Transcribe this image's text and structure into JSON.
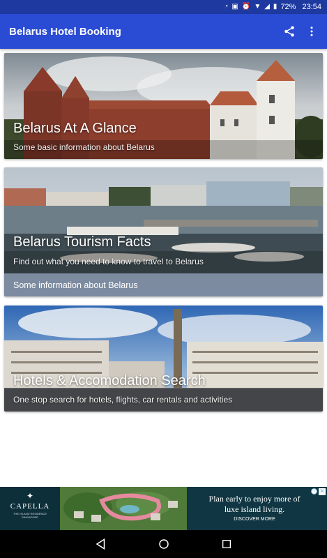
{
  "status_bar": {
    "battery": "72%",
    "time": "23:54"
  },
  "app_bar": {
    "title": "Belarus Hotel Booking"
  },
  "cards": [
    {
      "title": "Belarus At A Glance",
      "subtitle": "Some basic information about Belarus"
    },
    {
      "title": "Belarus Tourism Facts",
      "subtitle": "Find out what you need to know to travel to Belarus",
      "footer": "Some information about Belarus"
    },
    {
      "title": "Hotels & Accomodation Search",
      "subtitle": "One stop search for hotels, flights, car rentals and activities"
    }
  ],
  "ad": {
    "brand": "CAPELLA",
    "brand_sub": "THE ISLAND RESIDENCE\nSINGAPORE",
    "headline_line1": "Plan early to enjoy more of",
    "headline_line2": "luxe island living.",
    "cta": "DISCOVER MORE"
  },
  "icons": {
    "share": "share-icon",
    "overflow": "more-vert-icon",
    "back": "back-icon",
    "home": "home-icon",
    "recents": "recents-icon"
  },
  "colors": {
    "status_bar": "#1e39a0",
    "app_bar": "#2a4bd3",
    "card_footer": "#7c8ba0",
    "ad_bg": "#0f3642"
  }
}
